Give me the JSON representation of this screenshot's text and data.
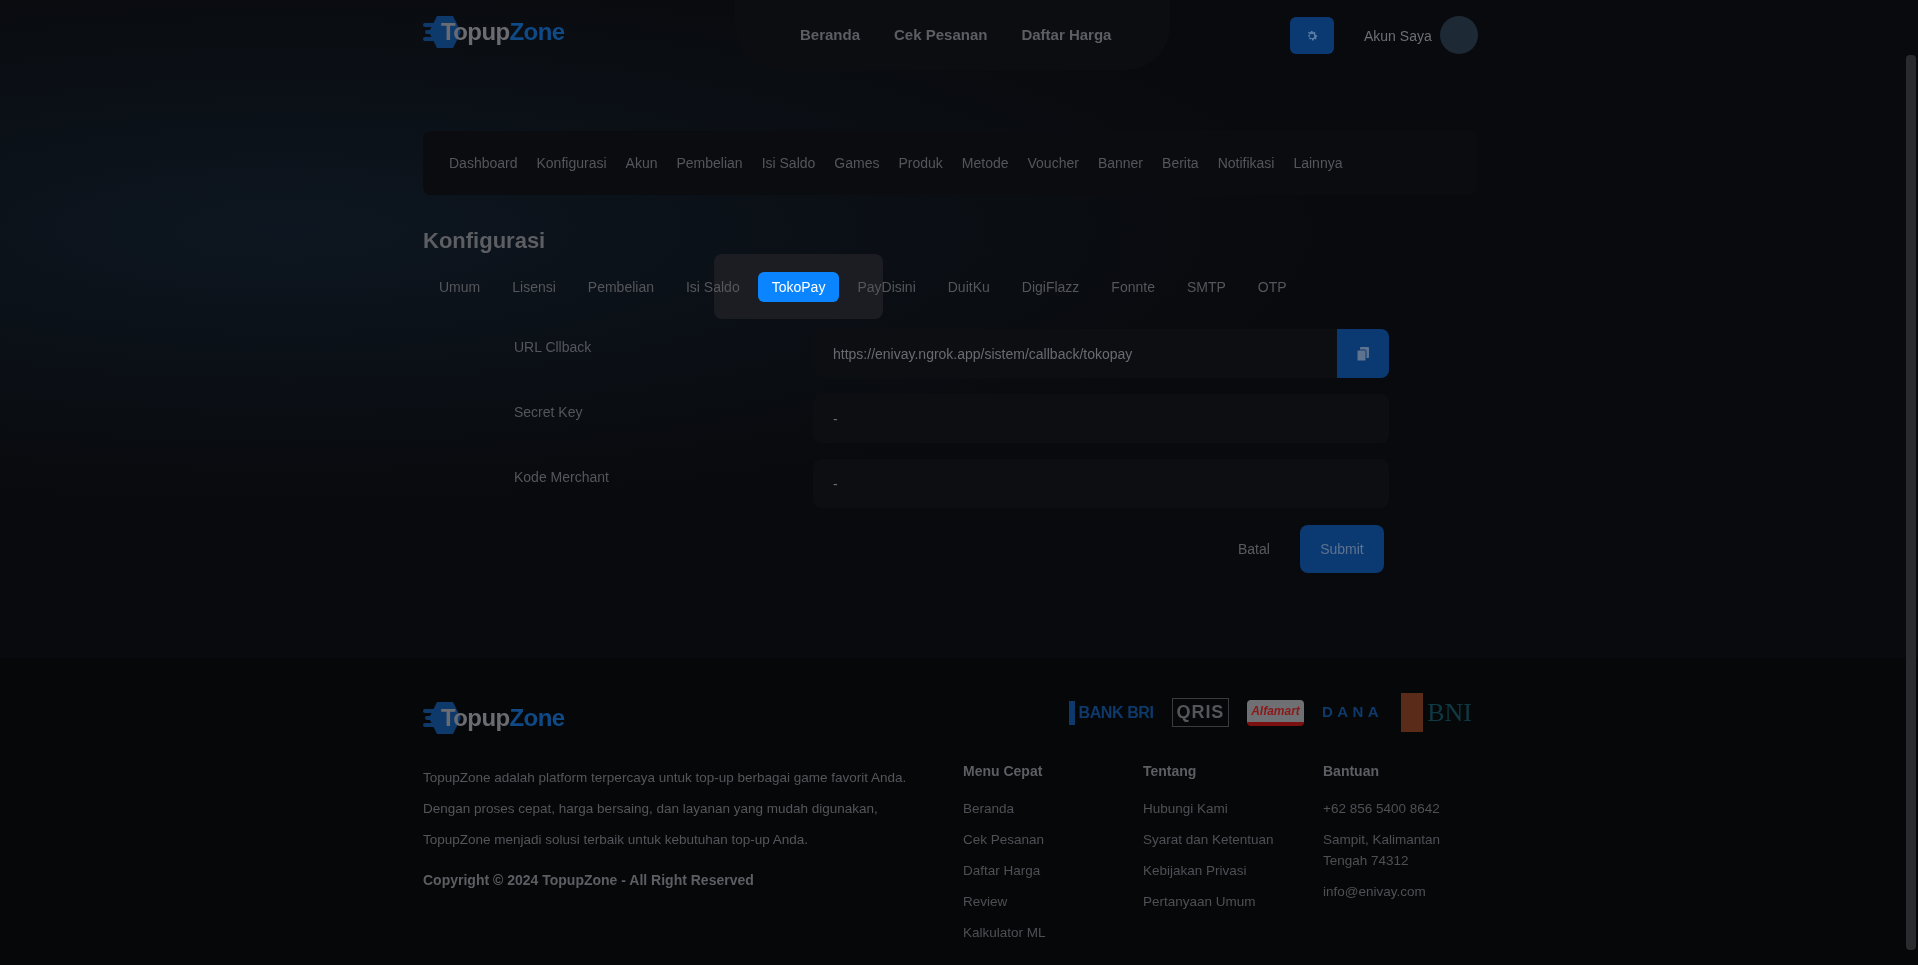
{
  "header": {
    "logo": {
      "part_1": "Topup",
      "part_2": "Zone"
    },
    "nav": [
      "Beranda",
      "Cek Pesanan",
      "Daftar Harga"
    ],
    "account_label": "Akun Saya"
  },
  "admin_menu": [
    "Dashboard",
    "Konfigurasi",
    "Akun",
    "Pembelian",
    "Isi Saldo",
    "Games",
    "Produk",
    "Metode",
    "Voucher",
    "Banner",
    "Berita",
    "Notifikasi",
    "Lainnya"
  ],
  "page_title": "Konfigurasi",
  "tabs": [
    {
      "label": "Umum",
      "selected": false
    },
    {
      "label": "Lisensi",
      "selected": false
    },
    {
      "label": "Pembelian",
      "selected": false
    },
    {
      "label": "Isi Saldo",
      "selected": false
    },
    {
      "label": "TokoPay",
      "selected": true
    },
    {
      "label": "PayDisini",
      "selected": false
    },
    {
      "label": "DuitKu",
      "selected": false
    },
    {
      "label": "DigiFlazz",
      "selected": false
    },
    {
      "label": "Fonnte",
      "selected": false
    },
    {
      "label": "SMTP",
      "selected": false
    },
    {
      "label": "OTP",
      "selected": false
    }
  ],
  "form": {
    "fields": [
      {
        "label": "URL Cllback",
        "value": "https://enivay.ngrok.app/sistem/callback/tokopay",
        "kind": "copy"
      },
      {
        "label": "Secret Key",
        "value": "-",
        "kind": "text"
      },
      {
        "label": "Kode Merchant",
        "value": "-",
        "kind": "text"
      }
    ],
    "cancel": "Batal",
    "submit": "Submit"
  },
  "footer": {
    "logo": {
      "part_1": "Topup",
      "part_2": "Zone"
    },
    "payment_logos": [
      {
        "kind": "bri",
        "label": "BANK BRI"
      },
      {
        "kind": "qris",
        "label": "QRIS"
      },
      {
        "kind": "alfamart",
        "label": "Alfamart"
      },
      {
        "kind": "dana",
        "label": "DANA"
      },
      {
        "kind": "bni",
        "label": "BNI"
      }
    ],
    "description": "TopupZone adalah platform terpercaya untuk top-up berbagai game favorit Anda. Dengan proses cepat, harga bersaing, dan layanan yang mudah digunakan, TopupZone menjadi solusi terbaik untuk kebutuhan top-up Anda.",
    "copyright": "Copyright © 2024 TopupZone - All Right Reserved",
    "columns": [
      {
        "title": "Menu Cepat",
        "items": [
          "Beranda",
          "Cek Pesanan",
          "Daftar Harga",
          "Review",
          "Kalkulator ML"
        ]
      },
      {
        "title": "Tentang",
        "items": [
          "Hubungi Kami",
          "Syarat dan Ketentuan",
          "Kebijakan Privasi",
          "Pertanyaan Umum"
        ]
      },
      {
        "title": "Bantuan",
        "items": [
          "+62 856 5400 8642",
          "Sampit, Kalimantan Tengah 74312",
          "info@enivay.com"
        ]
      }
    ]
  }
}
